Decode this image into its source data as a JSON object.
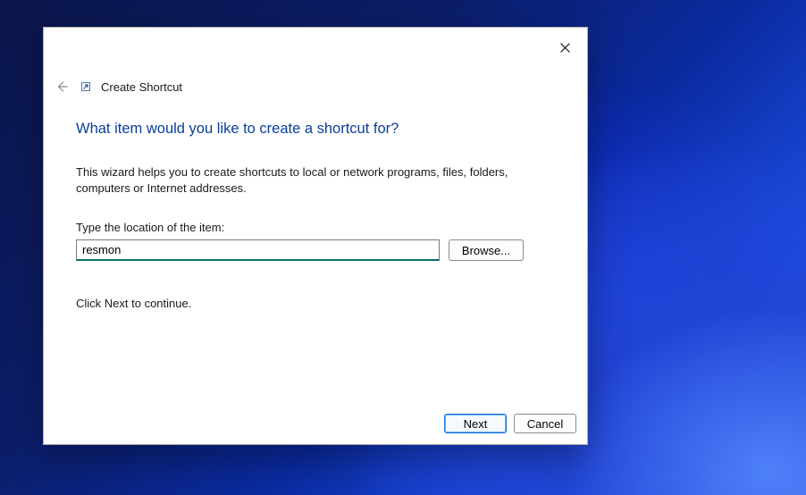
{
  "wizard": {
    "title": "Create Shortcut",
    "heading": "What item would you like to create a shortcut for?",
    "description": "This wizard helps you to create shortcuts to local or network programs, files, folders, computers or Internet addresses.",
    "location_label": "Type the location of the item:",
    "location_value": "resmon",
    "browse_label": "Browse...",
    "continue_text": "Click Next to continue."
  },
  "footer": {
    "next_label": "Next",
    "cancel_label": "Cancel"
  }
}
